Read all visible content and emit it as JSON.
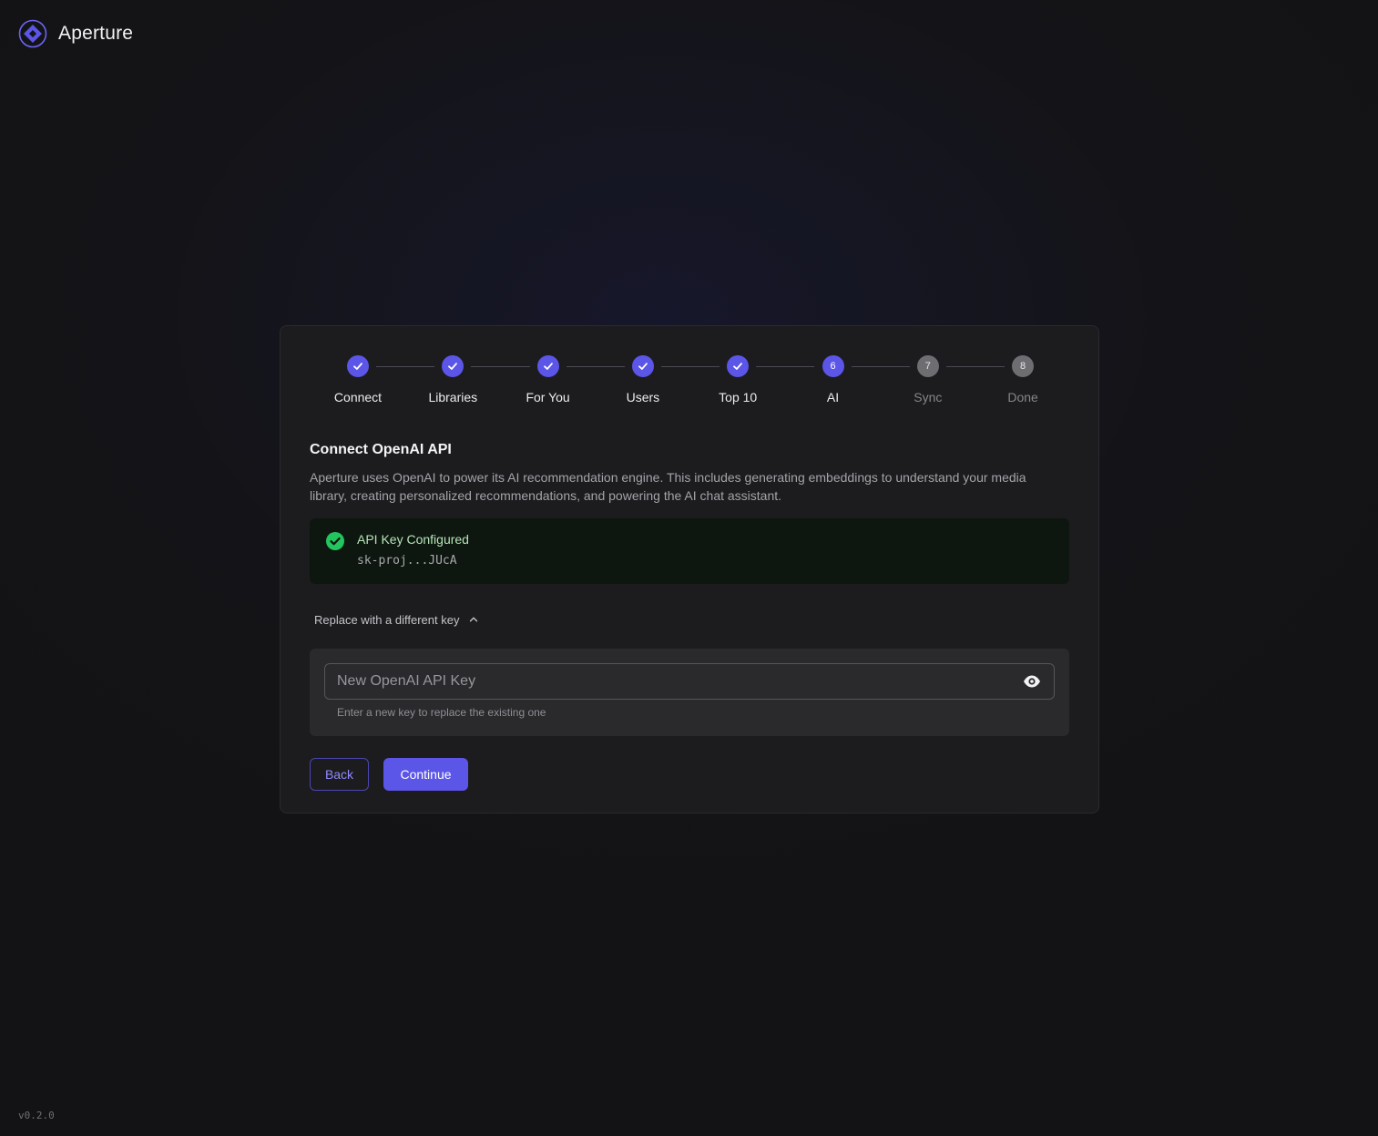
{
  "app": {
    "name": "Aperture",
    "version": "v0.2.0",
    "accent": "#5b55e8"
  },
  "stepper": {
    "steps": [
      {
        "label": "Connect",
        "state": "done",
        "number": "1",
        "icon": "check-icon"
      },
      {
        "label": "Libraries",
        "state": "done",
        "number": "2",
        "icon": "check-icon"
      },
      {
        "label": "For You",
        "state": "done",
        "number": "3",
        "icon": "check-icon"
      },
      {
        "label": "Users",
        "state": "done",
        "number": "4",
        "icon": "check-icon"
      },
      {
        "label": "Top 10",
        "state": "done",
        "number": "5",
        "icon": "check-icon"
      },
      {
        "label": "AI",
        "state": "active",
        "number": "6"
      },
      {
        "label": "Sync",
        "state": "pending",
        "number": "7"
      },
      {
        "label": "Done",
        "state": "pending",
        "number": "8"
      }
    ]
  },
  "section": {
    "title": "Connect OpenAI API",
    "description": "Aperture uses OpenAI to power its AI recommendation engine. This includes generating embeddings to understand your media library, creating personalized recommendations, and powering the AI chat assistant."
  },
  "status": {
    "title": "API Key Configured",
    "masked_key": "sk-proj...JUcA",
    "icon": "check-circle-icon",
    "color": "#22c55e"
  },
  "replace": {
    "toggle_label": "Replace with a different key",
    "expanded": true,
    "input_value": "",
    "input_placeholder": "New OpenAI API Key",
    "helper_text": "Enter a new key to replace the existing one",
    "visibility_icon": "eye-icon"
  },
  "actions": {
    "back_label": "Back",
    "continue_label": "Continue"
  }
}
